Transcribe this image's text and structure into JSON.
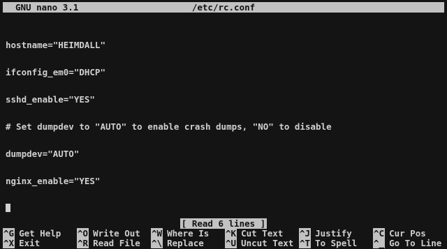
{
  "title_bar": {
    "app_name": "GNU nano 3.1",
    "file_name": "/etc/rc.conf"
  },
  "editor": {
    "lines": [
      "hostname=\"HEIMDALL\"",
      "ifconfig_em0=\"DHCP\"",
      "sshd_enable=\"YES\"",
      "# Set dumpdev to \"AUTO\" to enable crash dumps, \"NO\" to disable",
      "dumpdev=\"AUTO\"",
      "nginx_enable=\"YES\""
    ]
  },
  "status": {
    "message": "[ Read 6 lines ]"
  },
  "shortcuts": {
    "row1": [
      {
        "key": "^G",
        "label": "Get Help"
      },
      {
        "key": "^O",
        "label": "Write Out"
      },
      {
        "key": "^W",
        "label": "Where Is"
      },
      {
        "key": "^K",
        "label": "Cut Text"
      },
      {
        "key": "^J",
        "label": "Justify"
      },
      {
        "key": "^C",
        "label": "Cur Pos"
      }
    ],
    "row2": [
      {
        "key": "^X",
        "label": "Exit"
      },
      {
        "key": "^R",
        "label": "Read File"
      },
      {
        "key": "^\\",
        "label": "Replace"
      },
      {
        "key": "^U",
        "label": "Uncut Text"
      },
      {
        "key": "^T",
        "label": "To Spell"
      },
      {
        "key": "^_",
        "label": "Go To Line"
      }
    ]
  }
}
